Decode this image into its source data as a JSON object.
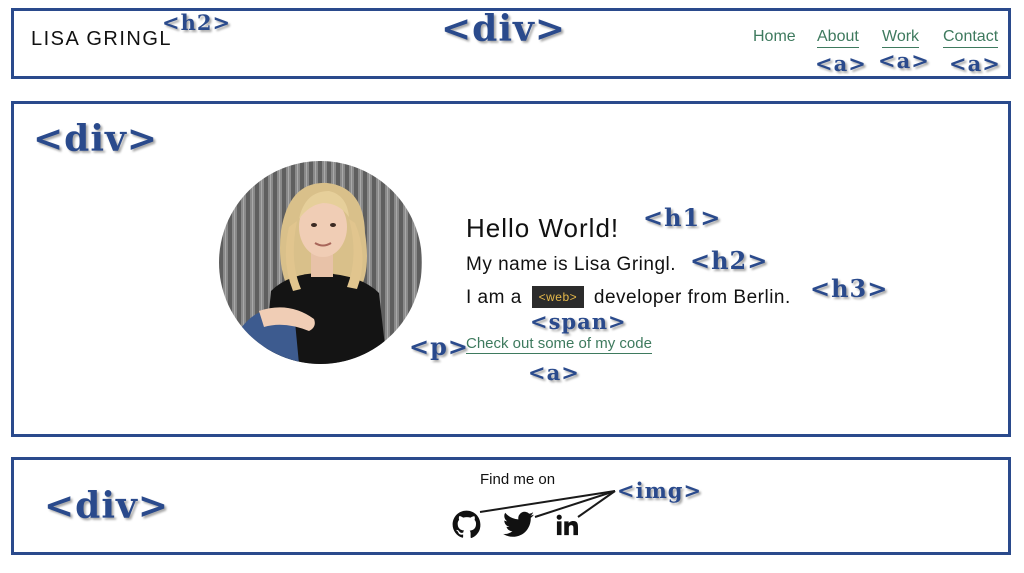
{
  "header": {
    "brand": "LISA GRINGL",
    "nav": [
      {
        "label": "Home"
      },
      {
        "label": "About"
      },
      {
        "label": "Work"
      },
      {
        "label": "Contact"
      }
    ]
  },
  "hero": {
    "greeting": "Hello World!",
    "name_line": "My name is Lisa Gringl.",
    "role_prefix": "I am a",
    "role_tag": "<web>",
    "role_suffix": "developer from Berlin.",
    "code_link": "Check out some of my code"
  },
  "footer": {
    "find_me": "Find me on",
    "icons": [
      "github-icon",
      "twitter-icon",
      "linkedin-icon"
    ]
  },
  "annotations": {
    "div": "<div>",
    "h1": "<h1>",
    "h2": "<h2>",
    "h3": "<h3>",
    "a": "<a>",
    "p": "<p>",
    "span": "<span>",
    "img": "<img>"
  },
  "colors": {
    "border": "#2a4a8c",
    "link": "#3e7a5e",
    "tag_bg": "#2b2b2b",
    "tag_text": "#e6b94a"
  }
}
